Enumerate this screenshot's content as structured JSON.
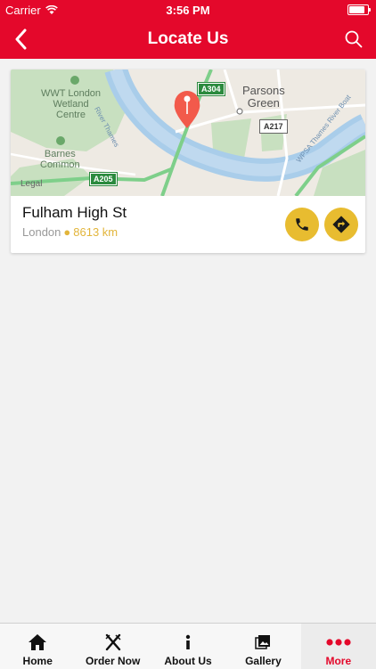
{
  "status_bar": {
    "carrier": "Carrier",
    "time": "3:56 PM",
    "battery_level": 0.95
  },
  "nav": {
    "title": "Locate Us",
    "back_icon": "chevron-left-icon",
    "search_icon": "search-icon"
  },
  "store": {
    "name": "Fulham High St",
    "city": "London",
    "separator": "●",
    "distance": "8613 km",
    "call_icon": "phone-icon",
    "directions_icon": "directions-icon"
  },
  "map": {
    "labels": {
      "wwt": [
        "WWT London",
        "Wetland",
        "Centre"
      ],
      "barnes": [
        "Barnes",
        "Common"
      ],
      "parsons": [
        "Parsons",
        "Green"
      ],
      "river_thames": "River Thames",
      "wpsa": "WPSA Thames River Boat"
    },
    "roads": {
      "a304": "A304",
      "a217": "A217",
      "a205": "A205"
    },
    "legal": "Legal"
  },
  "tabs": [
    {
      "label": "Home",
      "icon": "home-icon",
      "active": false
    },
    {
      "label": "Order Now",
      "icon": "utensils-icon",
      "active": false
    },
    {
      "label": "About Us",
      "icon": "info-icon",
      "active": false
    },
    {
      "label": "Gallery",
      "icon": "gallery-icon",
      "active": false
    },
    {
      "label": "More",
      "icon": "more-icon",
      "active": true
    }
  ],
  "colors": {
    "brand": "#e4082b",
    "accent": "#e8bc30",
    "distance": "#e2b53b"
  }
}
